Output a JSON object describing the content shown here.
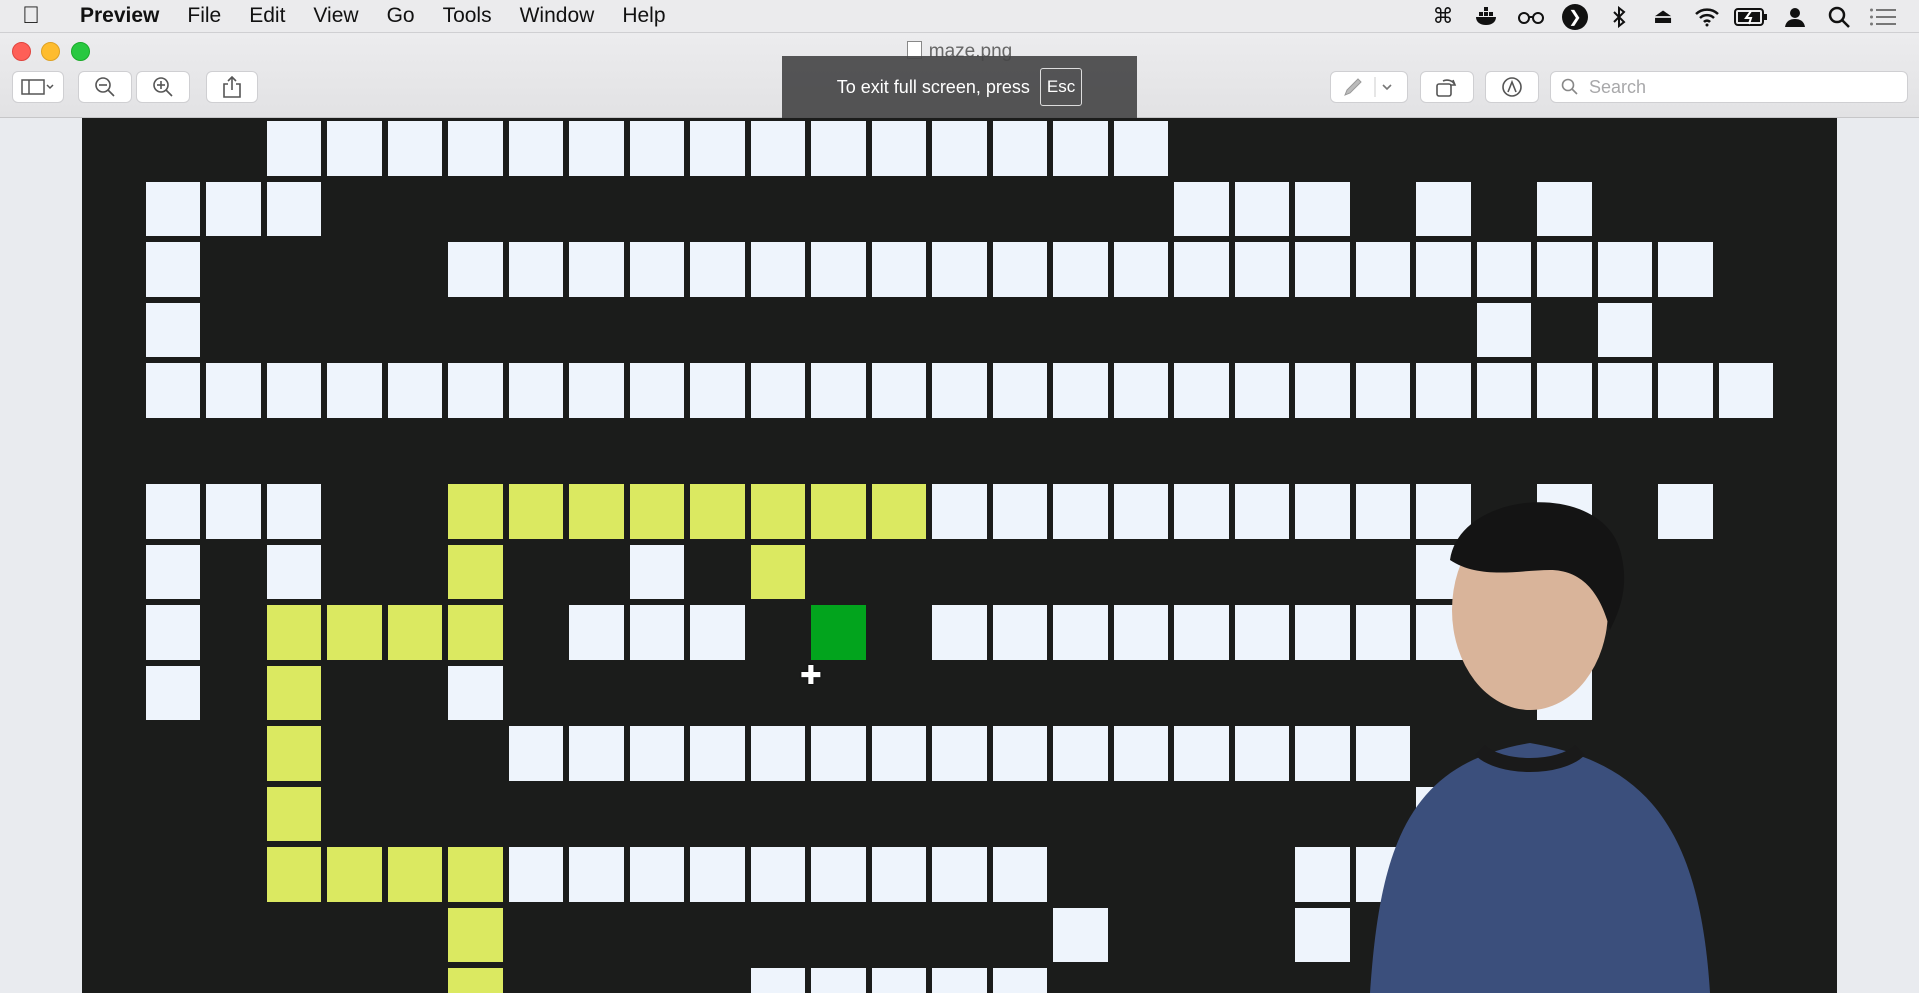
{
  "menubar": {
    "apple_icon": "apple-icon",
    "app_name": "Preview",
    "items": [
      "File",
      "Edit",
      "View",
      "Go",
      "Tools",
      "Window",
      "Help"
    ],
    "status_icons": [
      "command-icon",
      "docker-icon",
      "glasses-icon",
      "play-circle-icon",
      "bluetooth-icon",
      "eject-icon",
      "wifi-icon",
      "battery-icon",
      "user-icon",
      "search-icon",
      "list-icon"
    ]
  },
  "window": {
    "title": "maze.png",
    "toolbar": {
      "sidebar_icon": "sidebar-icon",
      "zoom_out_icon": "zoom-out-icon",
      "zoom_in_icon": "zoom-in-icon",
      "share_icon": "share-icon",
      "markup_icon": "pen-icon",
      "rotate_icon": "rotate-icon",
      "annotate_icon": "markup-icon"
    },
    "search": {
      "placeholder": "Search",
      "value": ""
    }
  },
  "fullscreen_toast": {
    "message": "To exit full screen, press",
    "key": "Esc"
  },
  "maze": {
    "colors": {
      "wall": "#1b1c1b",
      "open": "#eef4fc",
      "path": "#dbe961",
      "goal": "#02a41d"
    },
    "legend": {
      "#": "wall",
      ".": "open",
      "p": "path",
      "G": "goal"
    },
    "rows": [
      "###...............#########",
      "#...##############...#.#.##",
      "#.####.....................",
      "#.#####################.#.#",
      "#...........................",
      "###############################",
      "#...##pppppppp.........#.#.#",
      "#.#.##p##.#p##########.#.#",
      "#.#pppp#...#G#.........#.#",
      "#.#p##.#################.#",
      "###p###...............####",
      "###p##################.##",
      "###pppp.........####....#",
      "######p#########.###.#####",
      "######p####.....#########"
    ]
  }
}
